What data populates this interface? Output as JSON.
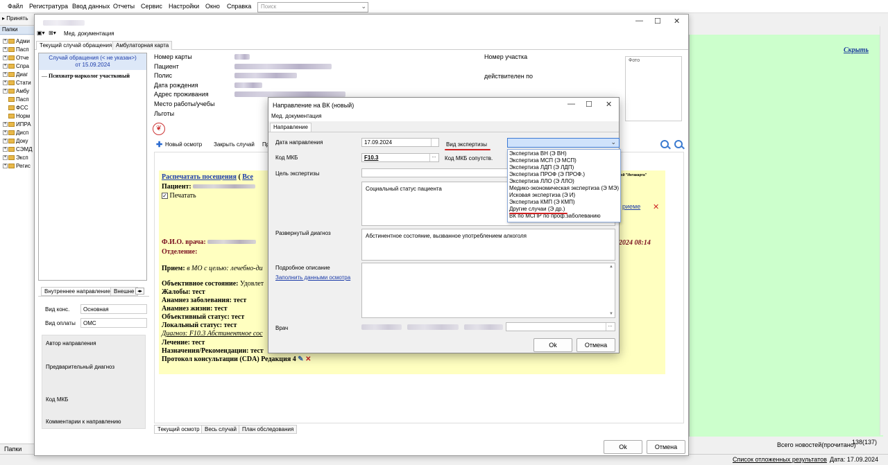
{
  "menu": [
    "Файл",
    "Регистратура",
    "Ввод данных",
    "Отчеты",
    "Сервис",
    "Настройки",
    "Окно",
    "Справка"
  ],
  "search_placeholder": "Поиск",
  "left_toolbar": {
    "accept": "Принять"
  },
  "folders_title": "Папки",
  "folders": [
    "Адми",
    "Пасп",
    "Отче",
    "Спра",
    "Диаг",
    "Стати",
    "Амбу",
    "Пасп",
    "ФСС",
    "Норм",
    "ИПРА",
    "Дисп",
    "Доку",
    "СЭМД",
    "Эксп",
    "Регис"
  ],
  "folders_bottom": "Папки",
  "hide_link": "Скрыть",
  "news_label": "Всего новостей(прочитано)",
  "news_count": "138(137)",
  "pending_link": "Список отложенных результатов",
  "status_date": "Дата: 17.09.2024",
  "med_window": {
    "toolbar_label": "Мед. документация",
    "tabs": [
      "Текущий случай обращения",
      "Амбулаторная карта"
    ],
    "case_header_1": "Случай обращения (< не указан>)",
    "case_header_2": "от 15.09.2024",
    "case_doctor": "Психиатр-нарколог участковый",
    "patient_labels": [
      "Номер карты",
      "Пациент",
      "Полис",
      "Дата рождения",
      "Адрес проживания",
      "Место работы/учебы",
      "Льготы"
    ],
    "district_label": "Номер участка",
    "valid_label": "действителен по",
    "photo_label": "Фото",
    "actions": {
      "new_visit": "Новый осмотр",
      "close_case": "Закрыть случай",
      "more": "Пр"
    },
    "visit": {
      "print_visits": "Распечатать посещения",
      "paren": "(",
      "all": "Все",
      "patient_label": "Пациент:",
      "print_checkbox": "Печатать",
      "doctor_label": "Ф.И.О. врача:",
      "dept_label": "Отделение:",
      "date_right": "2024 08:14",
      "system_note": "системой \"Интакарта\"",
      "link_right": "риеме",
      "reception_label": "Прием:",
      "reception_text": "в МО с целью:",
      "reception_value": "лечебно-ди",
      "objective_label": "Объективное состояние:",
      "objective_value": "Удовлет",
      "complaints": "Жалобы: тест",
      "anamnesis_disease": "Анамнез заболевания: тест",
      "anamnesis_life": "Анамнез жизни: тест",
      "objective_status": "Объективный статус: тест",
      "local_status": "Локальный статус: тест",
      "diagnosis": "Диагноз: F10.3 Абстинентное сос",
      "treatment": "Лечение: тест",
      "prescriptions": "Назначения/Рекомендации: тест",
      "protocol": "Протокол консультации (CDA) Редакция 4"
    },
    "left_tabs": [
      "Внутреннее направление",
      "Внешне"
    ],
    "consult_type_label": "Вид конс.",
    "consult_type_value": "Основная",
    "payment_label": "Вид оплаты",
    "payment_value": "ОМС",
    "author_label": "Автор направления",
    "prelim_label": "Предварительный диагноз",
    "mkb_label": "Код МКБ",
    "comments_label": "Комментарии к направлению",
    "bottom_tabs": [
      "Текущий осмотр",
      "Весь случай",
      "План обследования"
    ],
    "ok": "Ok",
    "cancel": "Отмена"
  },
  "dialog": {
    "title": "Направление на ВК (новый)",
    "subbar": "Мед. документация",
    "tab": "Направление",
    "date_label": "Дата направления",
    "date_value": "17.09.2024",
    "exp_type_label": "Вид экспертизы",
    "mkb_label": "Код МКБ",
    "mkb_value": "F10.3",
    "mkb_concomitant_label": "Код МКБ сопутств.",
    "purpose_label": "Цель экспертизы",
    "purpose_text": "Социальный статус пациента",
    "diagnosis_label": "Развернутый диагноз",
    "diagnosis_text": "Абстинентное состояние, вызванное употреблением алкоголя",
    "description_label": "Подробное описание",
    "fill_link": "Заполнить данными осмотра",
    "doctor_label": "Врач",
    "ok": "Ok",
    "cancel": "Отмена",
    "options": [
      "Экспертиза ВН (Э ВН)",
      "Экспертиза МСП (Э МСП)",
      "Экспертиза ЛДП (Э ЛДП)",
      "Экспертиза ПРОФ (Э ПРОФ.)",
      "Экспертиза ЛЛО (Э ЛЛО)",
      "Медико-экономическая экспертиза (Э МЭ)",
      "Исковая экспертиза (Э И)",
      "Экспертиза КМП (Э КМП)",
      "Другие случаи (Э др.)",
      "ВК по МСПР по проф.заболеванию"
    ]
  },
  "colors": {
    "accent": "#1a3aa8",
    "highlight_red": "#d02020",
    "green_panel": "#ccffcc",
    "visit_bg": "#ffffc0"
  }
}
